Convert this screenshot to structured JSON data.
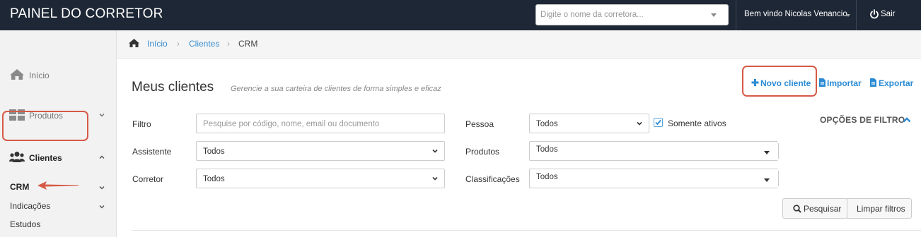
{
  "app": {
    "title": "PAINEL DO CORRETOR"
  },
  "header": {
    "broker_search_placeholder": "Digite o nome da corretora...",
    "welcome": "Bem vindo Nicolas Venancio",
    "logout": "Sair"
  },
  "breadcrumb": {
    "items": [
      "Início",
      "Clientes",
      "CRM"
    ],
    "separator": "›"
  },
  "sidebar": {
    "items": [
      {
        "label": "Início",
        "icon": "home-icon"
      },
      {
        "label": "Produtos",
        "icon": "grid-icon"
      },
      {
        "label": "Clientes",
        "icon": "users-icon"
      }
    ],
    "subitems": [
      "CRM",
      "Indicações",
      "Estudos"
    ]
  },
  "main": {
    "title": "Meus clientes",
    "subtitle": "Gerencie a sua carteira de clientes de forma simples e eficaz",
    "actions": {
      "new_client": "Novo cliente",
      "import": "Importar",
      "export": "Exportar"
    },
    "filter_options": "OPÇÕES DE FILTRO",
    "filters": {
      "filtro": {
        "label": "Filtro",
        "placeholder": "Pesquise por código, nome, email ou documento"
      },
      "assistente": {
        "label": "Assistente",
        "value": "Todos"
      },
      "corretor": {
        "label": "Corretor",
        "value": "Todos"
      },
      "pessoa": {
        "label": "Pessoa",
        "value": "Todos"
      },
      "somente_ativos": {
        "label": "Somente ativos",
        "checked": true
      },
      "produtos": {
        "label": "Produtos",
        "value": "Todos"
      },
      "classificacoes": {
        "label": "Classificações",
        "value": "Todos"
      }
    },
    "buttons": {
      "search": "Pesquisar",
      "clear": "Limpar filtros"
    }
  },
  "colors": {
    "topbar": "#1e2735",
    "accent": "#2a8bd4",
    "highlight": "#d65a47"
  }
}
